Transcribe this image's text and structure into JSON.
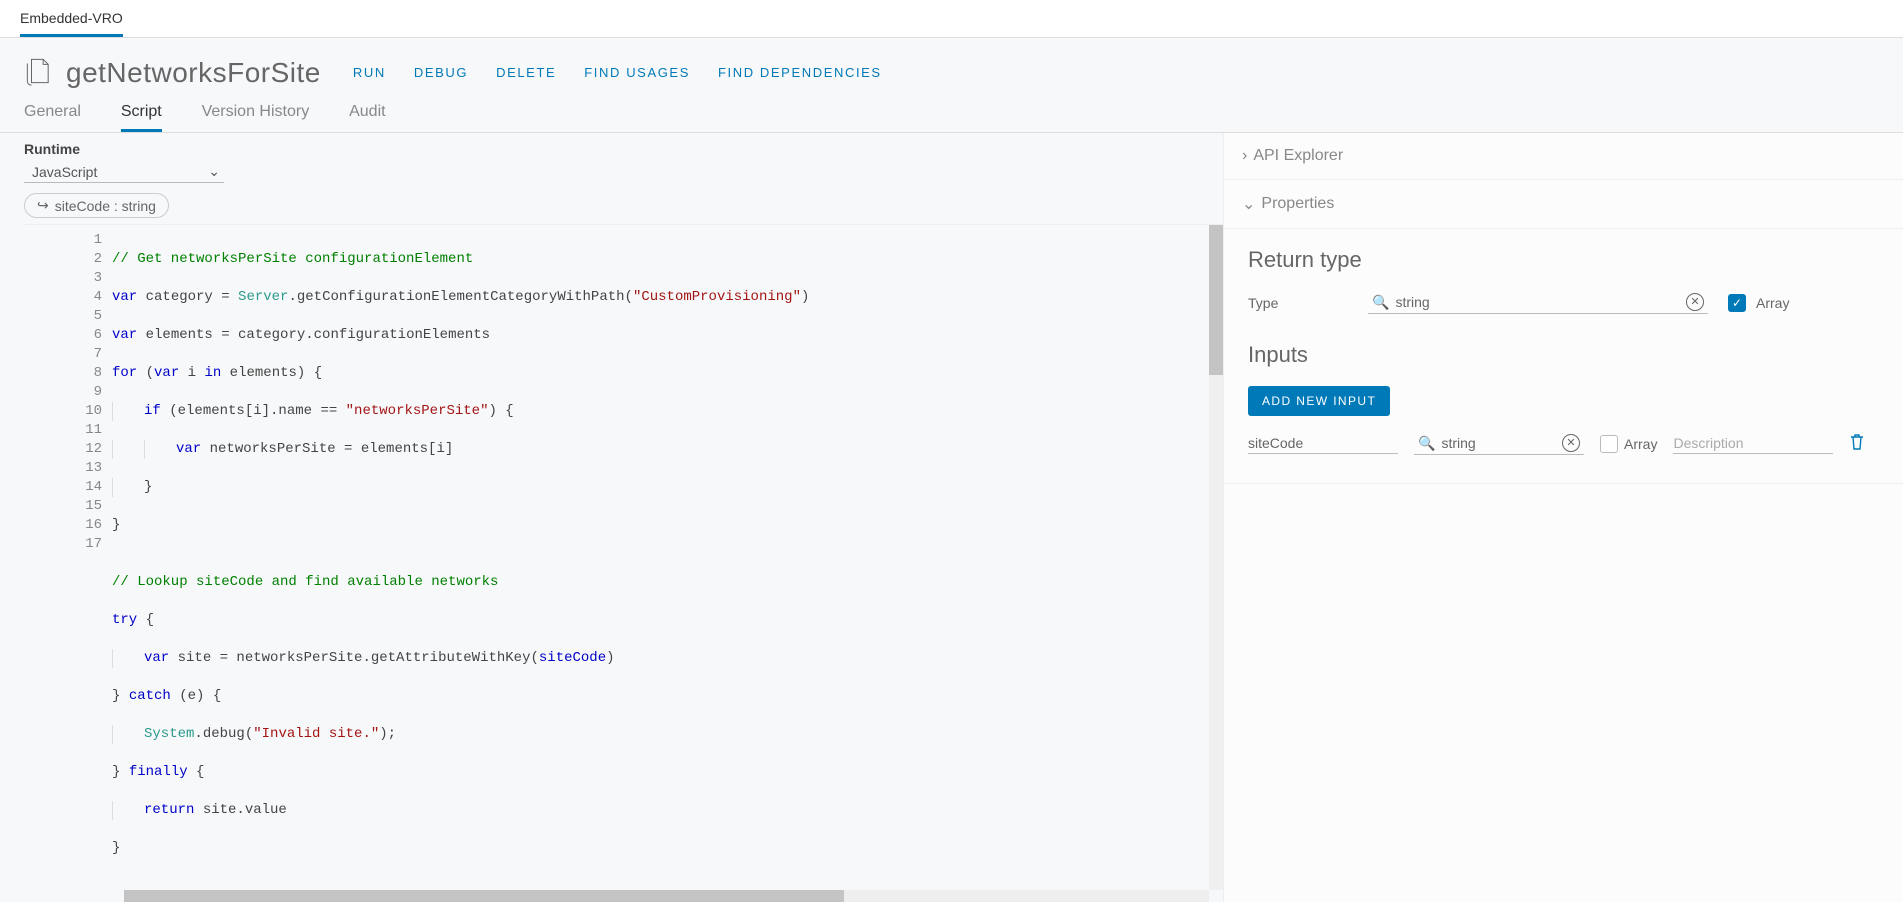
{
  "topTab": "Embedded-VRO",
  "title": "getNetworksForSite",
  "actions": {
    "run": "RUN",
    "debug": "DEBUG",
    "delete": "DELETE",
    "usages": "FIND USAGES",
    "deps": "FIND DEPENDENCIES"
  },
  "subTabs": {
    "general": "General",
    "script": "Script",
    "history": "Version History",
    "audit": "Audit"
  },
  "runtime": {
    "label": "Runtime",
    "value": "JavaScript"
  },
  "paramPill": "siteCode : string",
  "code": {
    "l1": "// Get networksPerSite configurationElement",
    "l2a": "var",
    "l2b": " category = ",
    "l2c": "Server",
    "l2d": ".getConfigurationElementCategoryWithPath(",
    "l2e": "\"CustomProvisioning\"",
    "l2f": ")",
    "l3a": "var",
    "l3b": " elements = category.configurationElements",
    "l4a": "for",
    "l4b": " (",
    "l4c": "var",
    "l4d": " i ",
    "l4e": "in",
    "l4f": " elements) {",
    "l5a": "if",
    "l5b": " (elements[i].name == ",
    "l5c": "\"networksPerSite\"",
    "l5d": ") {",
    "l6a": "var",
    "l6b": " networksPerSite = elements[i]",
    "l7": "}",
    "l8": "}",
    "l10": "// Lookup siteCode and find available networks",
    "l11a": "try",
    "l11b": " {",
    "l12a": "var",
    "l12b": " site = networksPerSite.getAttributeWithKey(",
    "l12c": "siteCode",
    "l12d": ")",
    "l13a": "} ",
    "l13b": "catch",
    "l13c": " (e) {",
    "l14a": "System",
    "l14b": ".debug(",
    "l14c": "\"Invalid site.\"",
    "l14d": ");",
    "l15a": "} ",
    "l15b": "finally",
    "l15c": " {",
    "l16a": "return",
    "l16b": " site.value",
    "l17": "}"
  },
  "lines": [
    "1",
    "2",
    "3",
    "4",
    "5",
    "6",
    "7",
    "8",
    "9",
    "10",
    "11",
    "12",
    "13",
    "14",
    "15",
    "16",
    "17"
  ],
  "right": {
    "apiExplorer": "API Explorer",
    "properties": "Properties",
    "returnTypeTitle": "Return type",
    "typeLabel": "Type",
    "typeValue": "string",
    "arrayLabel": "Array",
    "inputsTitle": "Inputs",
    "addInput": "ADD NEW INPUT",
    "input1": {
      "name": "siteCode",
      "type": "string",
      "array": "Array",
      "descPlaceholder": "Description"
    }
  }
}
